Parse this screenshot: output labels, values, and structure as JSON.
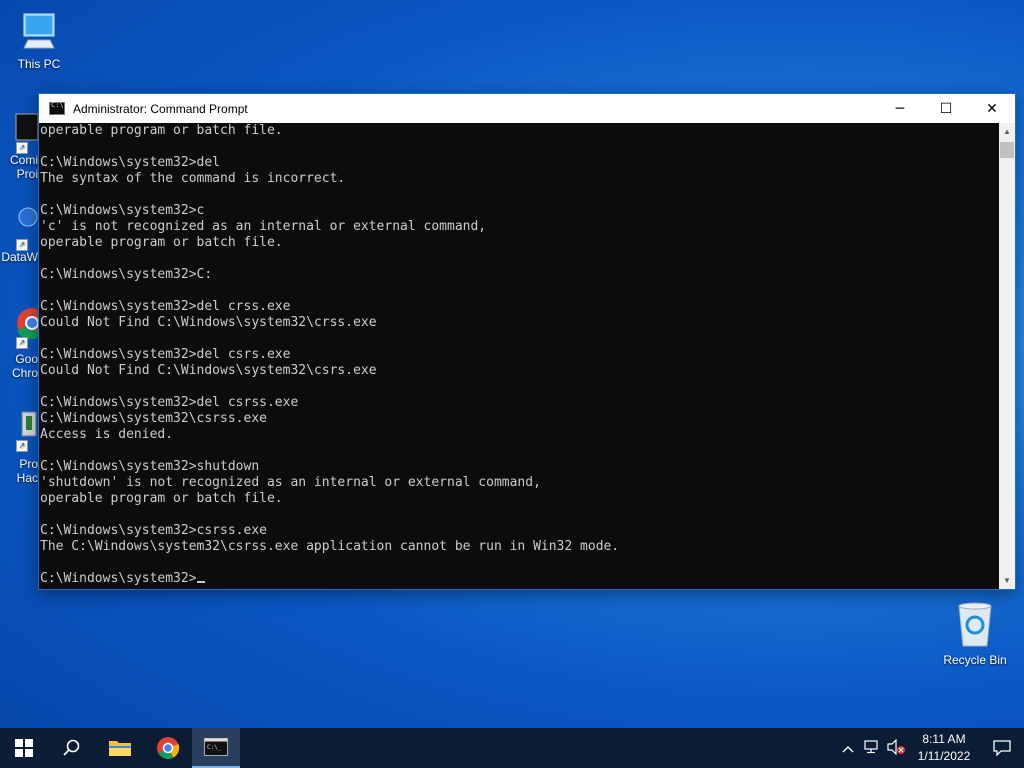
{
  "desktop": {
    "icons": [
      {
        "label": "This PC"
      },
      {
        "label": "Comi\nProi"
      },
      {
        "label": "DataW"
      },
      {
        "label": "Goo\nChro"
      },
      {
        "label": "Pro\nHac"
      }
    ],
    "recycle_bin_label": "Recycle Bin"
  },
  "window": {
    "title": "Administrator: Command Prompt",
    "controls": {
      "minimize": "─",
      "maximize": "☐",
      "close": "✕"
    },
    "console_lines": [
      "operable program or batch file.",
      "",
      "C:\\Windows\\system32>del",
      "The syntax of the command is incorrect.",
      "",
      "C:\\Windows\\system32>c",
      "'c' is not recognized as an internal or external command,",
      "operable program or batch file.",
      "",
      "C:\\Windows\\system32>C:",
      "",
      "C:\\Windows\\system32>del crss.exe",
      "Could Not Find C:\\Windows\\system32\\crss.exe",
      "",
      "C:\\Windows\\system32>del csrs.exe",
      "Could Not Find C:\\Windows\\system32\\csrs.exe",
      "",
      "C:\\Windows\\system32>del csrss.exe",
      "C:\\Windows\\system32\\csrss.exe",
      "Access is denied.",
      "",
      "C:\\Windows\\system32>shutdown",
      "'shutdown' is not recognized as an internal or external command,",
      "operable program or batch file.",
      "",
      "C:\\Windows\\system32>csrss.exe",
      "The C:\\Windows\\system32\\csrss.exe application cannot be run in Win32 mode.",
      ""
    ],
    "prompt": "C:\\Windows\\system32>"
  },
  "taskbar": {
    "time": "8:11 AM",
    "date": "1/11/2022"
  },
  "colors": {
    "console_bg": "#0c0c0c",
    "console_fg": "#cccccc",
    "taskbar_bg": "#0b1c35"
  }
}
